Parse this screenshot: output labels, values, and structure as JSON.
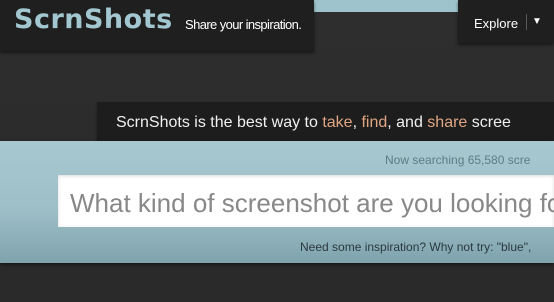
{
  "header": {
    "logo": "ScrnShots",
    "tagline": "Share your inspiration.",
    "explore_label": "Explore",
    "explore_caret": "▼"
  },
  "pitch": {
    "prefix": "ScrnShots is the best way to ",
    "take": "take",
    "sep1": ", ",
    "find": "find",
    "sep2": ", and ",
    "share": "share",
    "suffix": " scree"
  },
  "search": {
    "now_searching": "Now searching 65,580 scre",
    "placeholder": "What kind of screenshot are you looking fo",
    "suggest": "Need some inspiration? Why not try: \"blue\","
  },
  "colors": {
    "accent": "#a3c7d0",
    "highlight": "#e0a683",
    "panel": "#a8c8d0"
  }
}
